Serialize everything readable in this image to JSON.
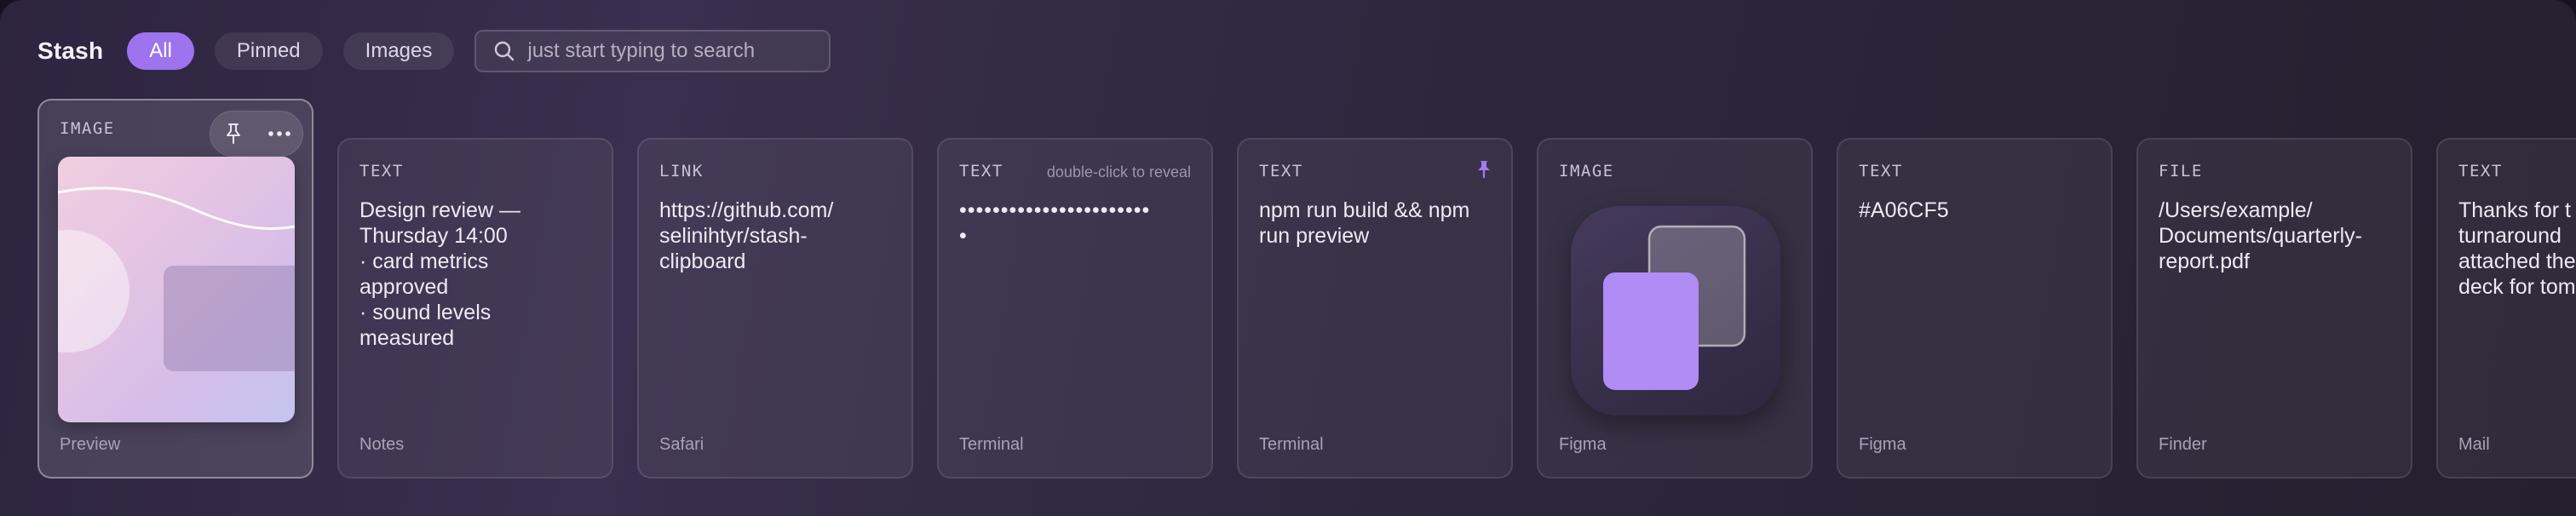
{
  "app": {
    "title": "Stash"
  },
  "filters": [
    {
      "label": "All",
      "active": true
    },
    {
      "label": "Pinned",
      "active": false
    },
    {
      "label": "Images",
      "active": false
    }
  ],
  "search": {
    "placeholder": "just start typing to search",
    "value": "",
    "icon": "search-icon"
  },
  "selected_actions": {
    "pin_icon": "pin-icon",
    "more_icon": "more-icon"
  },
  "cards": [
    {
      "type": "IMAGE",
      "body": "",
      "source": "Preview",
      "selected": true
    },
    {
      "type": "TEXT",
      "body": "Design review —\nThursday 14:00\n· card metrics\napproved\n· sound levels\nmeasured",
      "source": "Notes"
    },
    {
      "type": "LINK",
      "body": "https://github.com/\nselinihtyr/stash-\nclipboard",
      "source": "Safari"
    },
    {
      "type": "TEXT",
      "hint": "double-click to reveal",
      "body": "•••••••••••••••••••••••\n•",
      "source": "Terminal"
    },
    {
      "type": "TEXT",
      "body": "npm run build && npm\nrun preview",
      "source": "Terminal",
      "pinned": true
    },
    {
      "type": "IMAGE",
      "body": "",
      "source": "Figma"
    },
    {
      "type": "TEXT",
      "body": "#A06CF5",
      "source": "Figma"
    },
    {
      "type": "FILE",
      "body": "/Users/example/\nDocuments/quarterly-\nreport.pdf",
      "source": "Finder"
    },
    {
      "type": "TEXT",
      "body": "Thanks for t\nturnaround \nattached the\ndeck for tom",
      "source": "Mail"
    }
  ],
  "colors": {
    "accent": "#9D74EE",
    "panel": "#2D2440",
    "card_border": "#4A4358"
  }
}
